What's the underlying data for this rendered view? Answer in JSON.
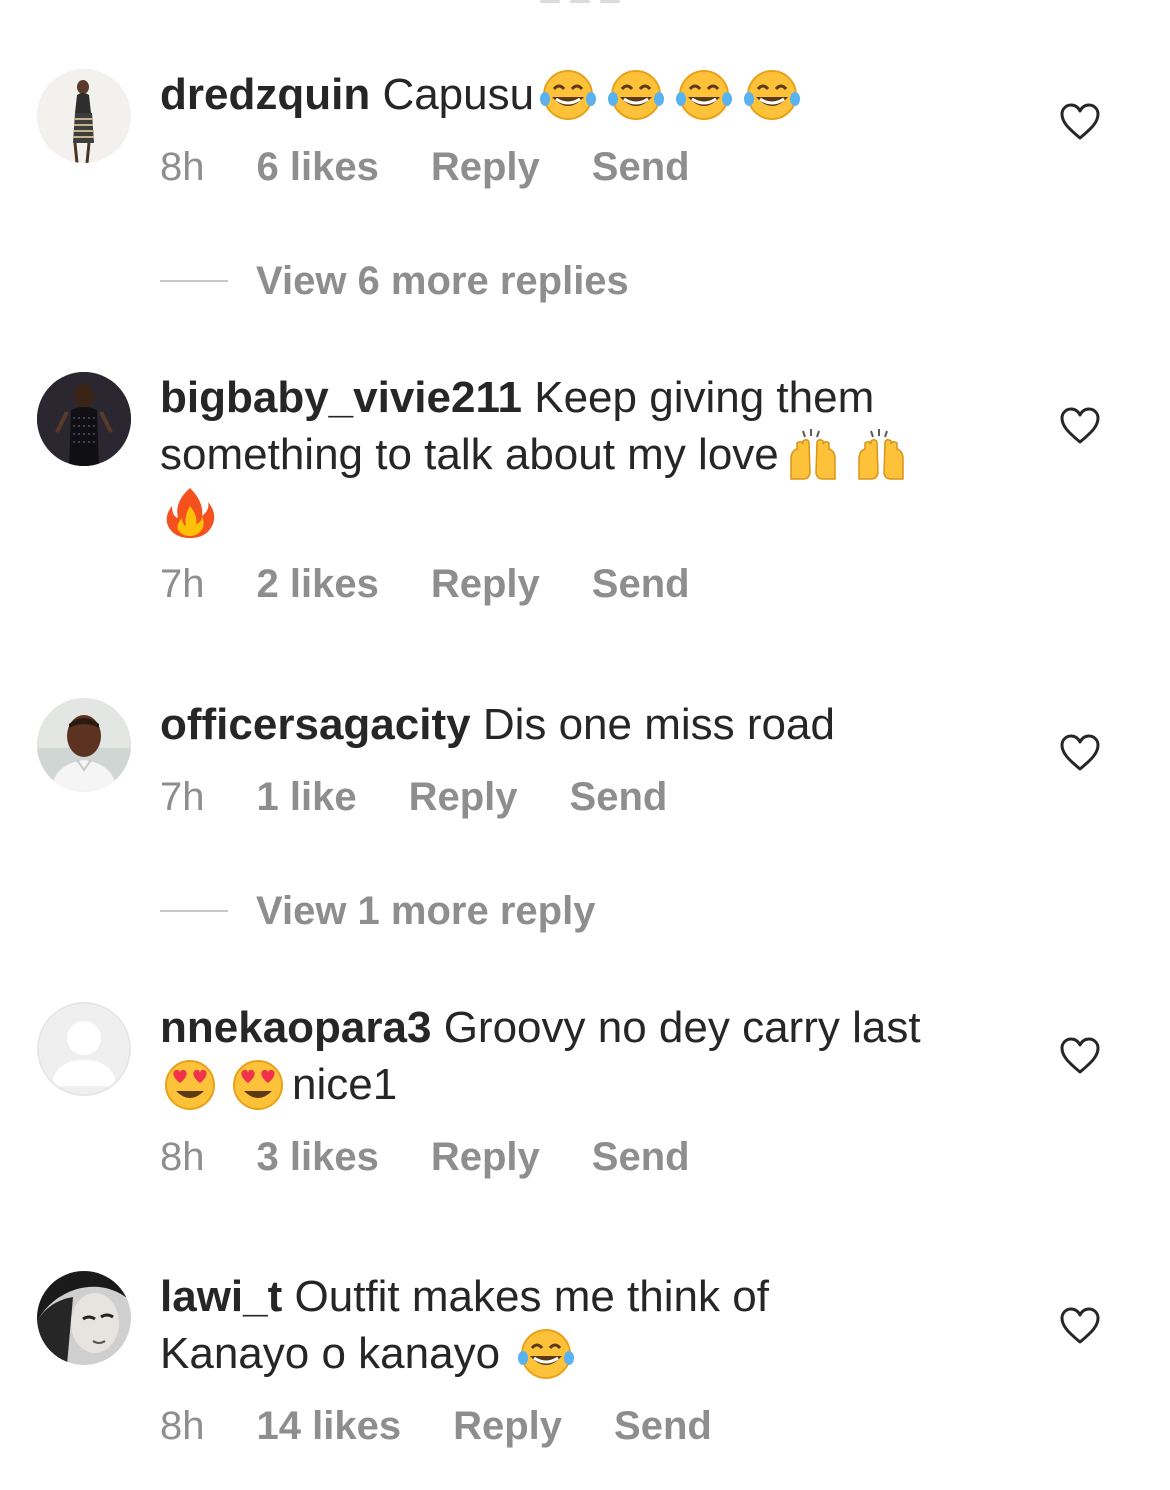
{
  "comments": [
    {
      "username": "dredzquin",
      "text": "Capusu",
      "text_after_emoji": "",
      "emojis": [
        "laughing-tears",
        "laughing-tears",
        "laughing-tears",
        "laughing-tears"
      ],
      "time": "8h",
      "likes": "6 likes",
      "reply_label": "Reply",
      "send_label": "Send"
    },
    {
      "username": "bigbaby_vivie211",
      "text": "Keep giving them something to talk about my love",
      "text_after_emoji": "",
      "emojis": [
        "raising-hands",
        "raising-hands",
        "fire"
      ],
      "time": "7h",
      "likes": "2 likes",
      "reply_label": "Reply",
      "send_label": "Send"
    },
    {
      "username": "officersagacity",
      "text": "Dis one miss road",
      "text_after_emoji": "",
      "emojis": [],
      "time": "7h",
      "likes": "1 like",
      "reply_label": "Reply",
      "send_label": "Send"
    },
    {
      "username": "nnekaopara3",
      "text": "Groovy no dey carry last",
      "text_after_emoji": "nice1",
      "emojis": [
        "heart-eyes",
        "heart-eyes"
      ],
      "time": "8h",
      "likes": "3 likes",
      "reply_label": "Reply",
      "send_label": "Send"
    },
    {
      "username": "lawi_t",
      "text": "Outfit makes me think of Kanayo o kanayo",
      "text_after_emoji": "",
      "emojis": [
        "laughing-tears"
      ],
      "time": "8h",
      "likes": "14 likes",
      "reply_label": "Reply",
      "send_label": "Send"
    }
  ],
  "view_replies": [
    {
      "label": "View 6 more replies"
    },
    {
      "label": "View 1 more reply"
    }
  ],
  "colors": {
    "text": "#262626",
    "secondary": "#8e8e8e",
    "divider": "#c7c7c7",
    "emoji_yellow": "#fdc23a",
    "emoji_outline": "#e8a21a",
    "heart_red": "#f0324a",
    "fire_orange": "#f4511e"
  },
  "icons": {
    "like": "heart-outline-icon",
    "laugh": "laughing-tears-emoji",
    "hands": "raising-hands-emoji",
    "fire": "fire-emoji",
    "heart_eyes": "heart-eyes-emoji",
    "default_avatar": "default-avatar-icon"
  }
}
